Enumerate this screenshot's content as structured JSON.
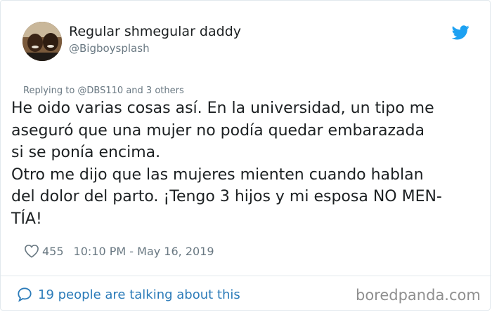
{
  "author": {
    "display_name": "Regular shmegular daddy",
    "handle": "@Bigboysplash"
  },
  "icons": {
    "platform": "twitter-bird-icon",
    "like": "heart-icon",
    "conversation": "speech-bubble-icon"
  },
  "colors": {
    "twitter_blue": "#1da1f2",
    "link_blue": "#2b7bb9",
    "secondary_text": "#697882",
    "primary_text": "#1c2022"
  },
  "reply_context": {
    "label": "Replying to @DBS110 and 3 others"
  },
  "tweet": {
    "lines": [
      "He oido varias cosas así. En la universidad, un tipo me",
      "aseguró que una mujer no podía quedar embarazada",
      "si se ponía encima.",
      "Otro me dijo que las mujeres mienten cuando hablan",
      "del dolor del parto. ¡Tengo 3 hijos y mi esposa NO MEN-",
      "TÍA!"
    ]
  },
  "meta": {
    "likes": "455",
    "timestamp": "10:10 PM - May 16, 2019"
  },
  "footer": {
    "conversation_label": "19 people are talking about this",
    "watermark": "boredpanda.com"
  }
}
